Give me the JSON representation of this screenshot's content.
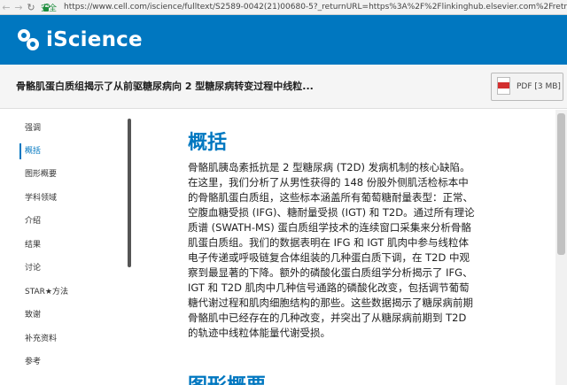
{
  "browser": {
    "secure_label": "安全",
    "url": "https://www.cell.com/iscience/fulltext/S2589-0042(21)00680-5?_returnURL=https%3A%2F%2Flinkinghub.elsevier.com%2Fretr"
  },
  "header": {
    "brand": "iScience"
  },
  "article": {
    "title": "骨骼肌蛋白质组揭示了从前驱糖尿病向 2 型糖尿病转变过程中线粒...",
    "pdf_label": "PDF [3 MB]"
  },
  "sidebar": {
    "items": [
      {
        "label": "强调"
      },
      {
        "label": "概括",
        "active": true
      },
      {
        "label": "图形概要"
      },
      {
        "label": "学科领域"
      },
      {
        "label": "介绍"
      },
      {
        "label": "结果"
      },
      {
        "label": "讨论"
      },
      {
        "label": "STAR★方法"
      },
      {
        "label": "致谢"
      },
      {
        "label": "补充资料"
      },
      {
        "label": "参考"
      }
    ]
  },
  "main": {
    "section_title": "概括",
    "abstract": "骨骼肌胰岛素抵抗是 2 型糖尿病 (T2D) 发病机制的核心缺陷。在这里，我们分析了从男性获得的 148 份股外侧肌活检标本中的骨骼肌蛋白质组，这些标本涵盖所有葡萄糖耐量表型：正常、空腹血糖受损 (IFG)、糖耐量受损 (IGT) 和 T2D。通过所有理论质谱 (SWATH-MS) 蛋白质组学技术的连续窗口采集来分析骨骼肌蛋白质组。我们的数据表明在 IFG 和 IGT 肌肉中参与线粒体电子传递或呼吸链复合体组装的几种蛋白质下调，在 T2D 中观察到最显著的下降。额外的磷酸化蛋白质组学分析揭示了 IFG、IGT 和 T2D 肌肉中几种信号通路的磷酸化改变，包括调节葡萄糖代谢过程和肌肉细胞结构的那些。这些数据揭示了糖尿病前期骨骼肌中已经存在的几种改变，并突出了从糖尿病前期到 T2D 的轨迹中线粒体能量代谢受损。",
    "next_section_title": "图形概要"
  },
  "colors": {
    "brand_blue": "#0077c0",
    "secure_green": "#1e8e3e"
  }
}
